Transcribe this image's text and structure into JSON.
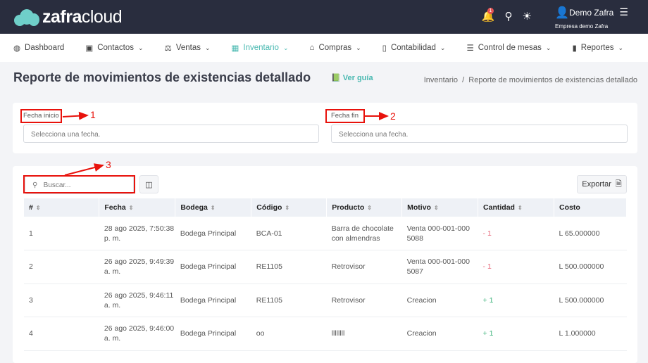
{
  "header": {
    "brand_bold": "zafra",
    "brand_light": "cloud",
    "notif_count": "1",
    "user_name": "Demo Zafra",
    "company": "Empresa demo Zafra"
  },
  "nav": [
    {
      "label": "Dashboard",
      "icon": "dashboard-icon"
    },
    {
      "label": "Contactos",
      "icon": "contacts-icon"
    },
    {
      "label": "Ventas",
      "icon": "sales-icon"
    },
    {
      "label": "Inventario",
      "icon": "inventory-icon",
      "active": true
    },
    {
      "label": "Compras",
      "icon": "store-icon"
    },
    {
      "label": "Contabilidad",
      "icon": "calculator-icon"
    },
    {
      "label": "Control de mesas",
      "icon": "table-icon"
    },
    {
      "label": "Reportes",
      "icon": "chart-icon"
    }
  ],
  "page": {
    "title": "Reporte de movimientos de existencias detallado",
    "guide": "Ver guía",
    "breadcrumb": [
      "Inventario",
      "Reporte de movimientos de existencias detallado"
    ]
  },
  "filters": {
    "start_label": "Fecha inicio",
    "start_placeholder": "Selecciona una fecha.",
    "end_label": "Fecha fin",
    "end_placeholder": "Selecciona una fecha."
  },
  "annotations": [
    "1",
    "2",
    "3"
  ],
  "toolbar": {
    "search_placeholder": "Buscar...",
    "export": "Exportar"
  },
  "table": {
    "headers": [
      "#",
      "Fecha",
      "Bodega",
      "Código",
      "Producto",
      "Motivo",
      "Cantidad",
      "Costo"
    ],
    "rows": [
      [
        "1",
        "28 ago 2025, 7:50:38 p. m.",
        "Bodega Principal",
        "BCA-01",
        "Barra de chocolate con almendras",
        "Venta 000-001-000 5088",
        "- 1",
        "L 65.000000"
      ],
      [
        "2",
        "26 ago 2025, 9:49:39 a. m.",
        "Bodega Principal",
        "RE1105",
        "Retrovisor",
        "Venta 000-001-000 5087",
        "- 1",
        "L 500.000000"
      ],
      [
        "3",
        "26 ago 2025, 9:46:11 a. m.",
        "Bodega Principal",
        "RE1105",
        "Retrovisor",
        "Creacion",
        "+ 1",
        "L 500.000000"
      ],
      [
        "4",
        "26 ago 2025, 9:46:00 a. m.",
        "Bodega Principal",
        "oo",
        "llllllll",
        "Creacion",
        "+ 1",
        "L 1.000000"
      ]
    ]
  }
}
